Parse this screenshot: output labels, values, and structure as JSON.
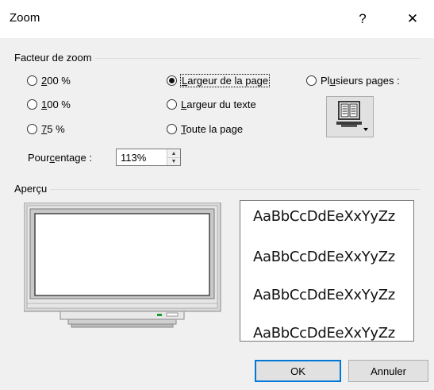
{
  "dialog": {
    "title": "Zoom",
    "help_label": "?",
    "close_label": "✕"
  },
  "zoom_factor": {
    "group_label": "Facteur de zoom",
    "options": [
      {
        "label": "200 %",
        "checked": false
      },
      {
        "label": "100 %",
        "checked": false
      },
      {
        "label": "75 %",
        "checked": false
      },
      {
        "label": "Largeur de la page",
        "checked": true
      },
      {
        "label": "Largeur du texte",
        "checked": false
      },
      {
        "label": "Toute la page",
        "checked": false
      },
      {
        "label": "Plusieurs pages :",
        "checked": false
      }
    ],
    "multi_pages_icon": "monitor-pages-icon",
    "percentage_label": "Pourcentage :",
    "percentage_value": "113%"
  },
  "preview": {
    "group_label": "Aperçu",
    "samples": [
      "AaBbCcDdEeXxYyZz",
      "AaBbCcDdEeXxYyZz",
      "AaBbCcDdEeXxYyZz",
      "AaBbCcDdEeXxYyZz"
    ]
  },
  "buttons": {
    "ok": "OK",
    "cancel": "Annuler"
  }
}
